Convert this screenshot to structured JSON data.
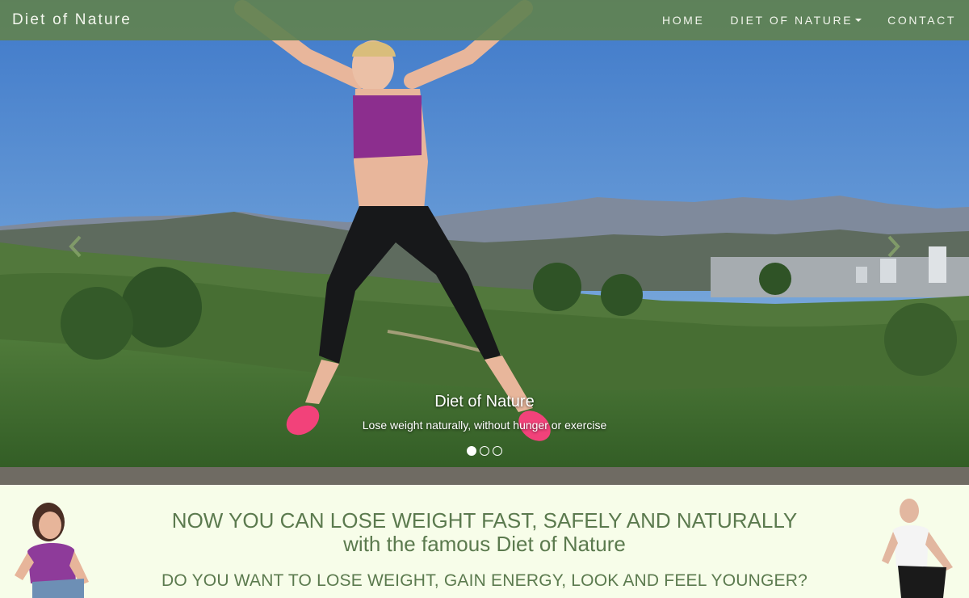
{
  "navbar": {
    "brand": "Diet of Nature",
    "links": [
      {
        "label": "HOME"
      },
      {
        "label": "DIET OF NATURE"
      },
      {
        "label": "CONTACT"
      }
    ]
  },
  "carousel": {
    "caption_title": "Diet of Nature",
    "caption_text": "Lose weight naturally, without hunger or exercise",
    "slide_count": 3,
    "active_slide": 1
  },
  "intro": {
    "headline_line1": "NOW YOU CAN LOSE WEIGHT FAST, SAFELY AND NATURALLY",
    "headline_line2": "with the famous Diet of Nature",
    "subheadline": "DO YOU WANT TO LOSE WEIGHT, GAIN ENERGY, LOOK AND FEEL YOUNGER?"
  },
  "colors": {
    "navbar": "#618252",
    "accent_text": "#5b7a4e",
    "page_background": "#f7fde9"
  },
  "icons": [
    "chevron-left-icon",
    "chevron-right-icon",
    "caret-down-icon"
  ]
}
